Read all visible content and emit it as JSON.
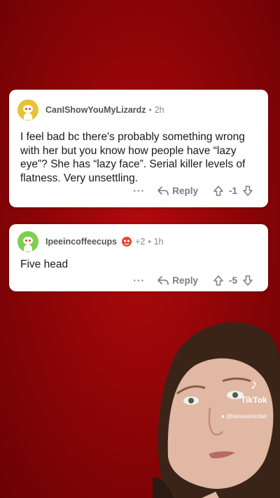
{
  "comments": [
    {
      "username": "CanIShowYouMyLizardz",
      "separator": "•",
      "time": "2h",
      "text": "I feel bad bc there's probably something wrong with her but you know how people have “lazy eye”? She has “lazy face”. Serial killer levels of flatness. Very unsettling.",
      "more": "···",
      "reply_label": "Reply",
      "score": "-1",
      "avatar_color": "#e8c235"
    },
    {
      "username": "Ipeeincoffeecups",
      "karma": "+2",
      "separator": "•",
      "time": "1h",
      "text": "Five head",
      "more": "···",
      "reply_label": "Reply",
      "score": "-5",
      "avatar_color": "#7dcf4d"
    }
  ],
  "watermark": {
    "brand": "TikTok",
    "handle": "@lanasaintclair"
  },
  "colors": {
    "background": "#a0070b",
    "card": "#ffffff"
  }
}
